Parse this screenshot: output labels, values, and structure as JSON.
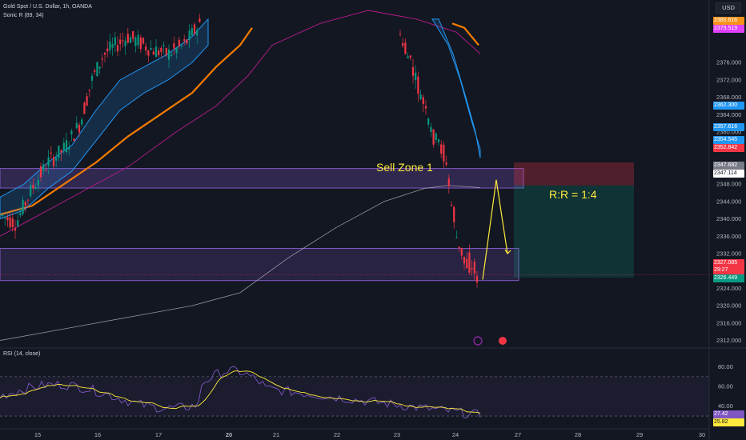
{
  "header": {
    "symbol_line": "Gold Spot / U.S. Dollar, 1h, OANDA",
    "indicator_line": "Sonic R (89, 34)",
    "currency": "USD"
  },
  "annotations": {
    "sell_zone": "Sell Zone 1",
    "risk_reward": "R:R = 1:4"
  },
  "rsi": {
    "label": "RSI (14, close)",
    "ticks": [
      "80.00",
      "60.00",
      "40.00"
    ],
    "value_badge": "27.42",
    "ma_badge": "25.82",
    "upper_band": 70,
    "lower_band": 30
  },
  "price_badges": [
    {
      "text": "2380.616",
      "color": "#f7931a"
    },
    {
      "text": "2379.519",
      "color": "#e040fb"
    },
    {
      "text": "2362.300",
      "color": "#2196f3"
    },
    {
      "text": "2357.616",
      "color": "#2196f3"
    },
    {
      "text": "2354.545",
      "color": "#2196f3"
    },
    {
      "text": "2352.842",
      "color": "#f23645"
    },
    {
      "text": "2347.682",
      "color": "#787b86"
    },
    {
      "text": "2347.114",
      "color": "#ffffff"
    },
    {
      "text": "2327.085",
      "color": "#f23645"
    },
    {
      "text": "29:27",
      "color": "#f23645"
    },
    {
      "text": "2326.449",
      "color": "#089981"
    }
  ],
  "colors": {
    "background": "#131722",
    "up": "#089981",
    "down": "#f23645",
    "zone": "#7e57c2",
    "orange_ma": "#f57c00",
    "magenta_ma": "#b71c8e",
    "blue_band": "#2196f3",
    "arrow": "#ffeb3b"
  },
  "chart_data": {
    "type": "candlestick",
    "y_ticks": [
      2312,
      2316,
      2320,
      2324,
      2328,
      2332,
      2336,
      2340,
      2344,
      2348,
      2352,
      2356,
      2360,
      2364,
      2368,
      2372,
      2376
    ],
    "x_tick_labels": [
      "15",
      "16",
      "17",
      "20",
      "21",
      "22",
      "23",
      "24",
      "27",
      "28",
      "29",
      "30"
    ],
    "sell_zone_1": [
      2347.1,
      2351.6
    ],
    "lower_zone": [
      2325.8,
      2333.2
    ],
    "trade_box": {
      "entry": 2347.7,
      "stop": 2353.0,
      "target": 2326.5,
      "risk_reward": "1:4"
    },
    "last_price": 2327.085,
    "ylim": [
      2310,
      2381
    ]
  }
}
